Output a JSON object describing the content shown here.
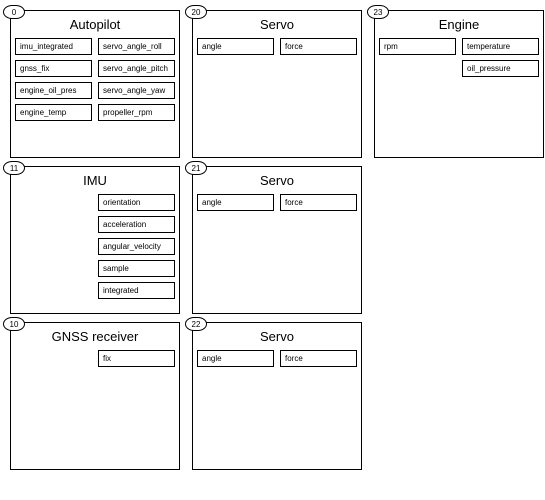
{
  "nodes": [
    {
      "id": "0",
      "title": "Autopilot",
      "left_ports": [
        "imu_integrated",
        "gnss_fix",
        "engine_oil_pres",
        "engine_temp"
      ],
      "right_ports": [
        "servo_angle_roll",
        "servo_angle_pitch",
        "servo_angle_yaw",
        "propeller_rpm"
      ]
    },
    {
      "id": "20",
      "title": "Servo",
      "left_ports": [
        "angle"
      ],
      "right_ports": [
        "force"
      ]
    },
    {
      "id": "23",
      "title": "Engine",
      "left_ports": [
        "rpm"
      ],
      "right_ports": [
        "temperature",
        "oil_pressure"
      ]
    },
    {
      "id": "11",
      "title": "IMU",
      "left_ports": [],
      "right_ports": [
        "orientation",
        "acceleration",
        "angular_velocity",
        "sample",
        "integrated"
      ]
    },
    {
      "id": "21",
      "title": "Servo",
      "left_ports": [
        "angle"
      ],
      "right_ports": [
        "force"
      ]
    },
    {
      "id": "blank",
      "blank": true
    },
    {
      "id": "10",
      "title": "GNSS receiver",
      "left_ports": [],
      "right_ports": [
        "fix"
      ]
    },
    {
      "id": "22",
      "title": "Servo",
      "left_ports": [
        "angle"
      ],
      "right_ports": [
        "force"
      ]
    }
  ]
}
